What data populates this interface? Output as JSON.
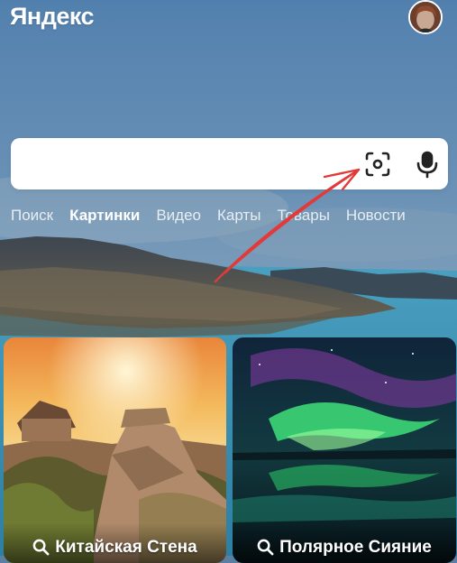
{
  "header": {
    "logo_text": "Яндекс"
  },
  "search": {
    "value": "",
    "placeholder": "",
    "lens_icon": "image-search-lens-icon",
    "mic_icon": "microphone-icon"
  },
  "nav": {
    "items": [
      {
        "label": "Поиск",
        "active": false
      },
      {
        "label": "Картинки",
        "active": true
      },
      {
        "label": "Видео",
        "active": false
      },
      {
        "label": "Карты",
        "active": false
      },
      {
        "label": "Товары",
        "active": false
      },
      {
        "label": "Новости",
        "active": false
      }
    ]
  },
  "cards": [
    {
      "title": "Китайская Стена",
      "icon": "search-icon"
    },
    {
      "title": "Полярное Сияние",
      "icon": "search-icon"
    }
  ],
  "colors": {
    "sky_top": "#4f7bab",
    "sky_mid": "#6f96b8",
    "water": "#3c8fb0",
    "annotation_arrow": "#e23a3a"
  }
}
